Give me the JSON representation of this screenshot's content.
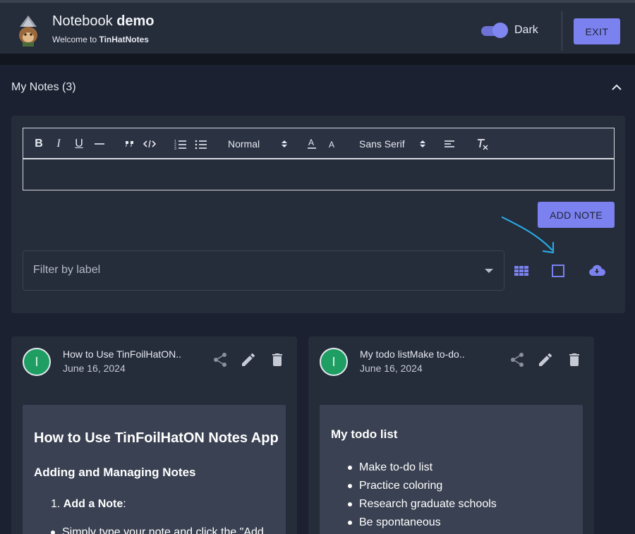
{
  "header": {
    "title_prefix": "Notebook",
    "title_bold": "demo",
    "subtitle_prefix": "Welcome to",
    "subtitle_bold": "TinHatNotes",
    "theme_toggle_label": "Dark",
    "theme_toggle_on": true,
    "exit_label": "EXIT"
  },
  "notes_section": {
    "title": "My Notes (3)"
  },
  "editor": {
    "toolbar": {
      "bold": "B",
      "italic": "I",
      "underline": "U",
      "heading_select": "Normal",
      "font_select": "Sans Serif"
    },
    "content": ""
  },
  "actions": {
    "add_note_label": "ADD NOTE"
  },
  "filter": {
    "placeholder": "Filter by label"
  },
  "view_icons": [
    "grid-view-icon",
    "single-view-icon",
    "cloud-download-icon"
  ],
  "cards": [
    {
      "avatar_letter": "I",
      "title": "How to Use TinFoilHatON..",
      "date": "June 16, 2024",
      "body": {
        "heading": "How to Use TinFoilHatON Notes App",
        "subheading": "Adding and Managing Notes",
        "list_number": "1.",
        "list_item_bold": "Add a Note",
        "list_item_suffix": ":",
        "bullet_text": "Simply type your note and click the \"Add"
      }
    },
    {
      "avatar_letter": "I",
      "title": "My todo listMake to-do..",
      "date": "June 16, 2024",
      "body": {
        "heading": "My todo list",
        "items": [
          "Make to-do list",
          "Practice coloring",
          "Research graduate schools",
          "Be spontaneous"
        ]
      }
    }
  ],
  "colors": {
    "accent": "#7b82ef",
    "background": "#1b2130",
    "surface": "#252c3a",
    "avatar": "#1f9e63",
    "annotation_arrow": "#29a8e0"
  }
}
